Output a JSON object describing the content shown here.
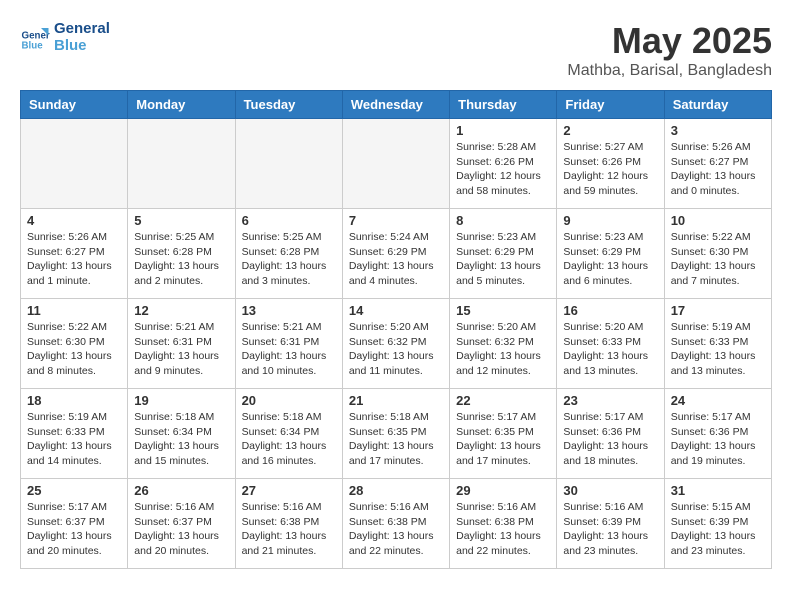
{
  "logo": {
    "line1": "General",
    "line2": "Blue"
  },
  "title": "May 2025",
  "location": "Mathba, Barisal, Bangladesh",
  "days_of_week": [
    "Sunday",
    "Monday",
    "Tuesday",
    "Wednesday",
    "Thursday",
    "Friday",
    "Saturday"
  ],
  "weeks": [
    [
      {
        "day": "",
        "info": ""
      },
      {
        "day": "",
        "info": ""
      },
      {
        "day": "",
        "info": ""
      },
      {
        "day": "",
        "info": ""
      },
      {
        "day": "1",
        "info": "Sunrise: 5:28 AM\nSunset: 6:26 PM\nDaylight: 12 hours and 58 minutes."
      },
      {
        "day": "2",
        "info": "Sunrise: 5:27 AM\nSunset: 6:26 PM\nDaylight: 12 hours and 59 minutes."
      },
      {
        "day": "3",
        "info": "Sunrise: 5:26 AM\nSunset: 6:27 PM\nDaylight: 13 hours and 0 minutes."
      }
    ],
    [
      {
        "day": "4",
        "info": "Sunrise: 5:26 AM\nSunset: 6:27 PM\nDaylight: 13 hours and 1 minute."
      },
      {
        "day": "5",
        "info": "Sunrise: 5:25 AM\nSunset: 6:28 PM\nDaylight: 13 hours and 2 minutes."
      },
      {
        "day": "6",
        "info": "Sunrise: 5:25 AM\nSunset: 6:28 PM\nDaylight: 13 hours and 3 minutes."
      },
      {
        "day": "7",
        "info": "Sunrise: 5:24 AM\nSunset: 6:29 PM\nDaylight: 13 hours and 4 minutes."
      },
      {
        "day": "8",
        "info": "Sunrise: 5:23 AM\nSunset: 6:29 PM\nDaylight: 13 hours and 5 minutes."
      },
      {
        "day": "9",
        "info": "Sunrise: 5:23 AM\nSunset: 6:29 PM\nDaylight: 13 hours and 6 minutes."
      },
      {
        "day": "10",
        "info": "Sunrise: 5:22 AM\nSunset: 6:30 PM\nDaylight: 13 hours and 7 minutes."
      }
    ],
    [
      {
        "day": "11",
        "info": "Sunrise: 5:22 AM\nSunset: 6:30 PM\nDaylight: 13 hours and 8 minutes."
      },
      {
        "day": "12",
        "info": "Sunrise: 5:21 AM\nSunset: 6:31 PM\nDaylight: 13 hours and 9 minutes."
      },
      {
        "day": "13",
        "info": "Sunrise: 5:21 AM\nSunset: 6:31 PM\nDaylight: 13 hours and 10 minutes."
      },
      {
        "day": "14",
        "info": "Sunrise: 5:20 AM\nSunset: 6:32 PM\nDaylight: 13 hours and 11 minutes."
      },
      {
        "day": "15",
        "info": "Sunrise: 5:20 AM\nSunset: 6:32 PM\nDaylight: 13 hours and 12 minutes."
      },
      {
        "day": "16",
        "info": "Sunrise: 5:20 AM\nSunset: 6:33 PM\nDaylight: 13 hours and 13 minutes."
      },
      {
        "day": "17",
        "info": "Sunrise: 5:19 AM\nSunset: 6:33 PM\nDaylight: 13 hours and 13 minutes."
      }
    ],
    [
      {
        "day": "18",
        "info": "Sunrise: 5:19 AM\nSunset: 6:33 PM\nDaylight: 13 hours and 14 minutes."
      },
      {
        "day": "19",
        "info": "Sunrise: 5:18 AM\nSunset: 6:34 PM\nDaylight: 13 hours and 15 minutes."
      },
      {
        "day": "20",
        "info": "Sunrise: 5:18 AM\nSunset: 6:34 PM\nDaylight: 13 hours and 16 minutes."
      },
      {
        "day": "21",
        "info": "Sunrise: 5:18 AM\nSunset: 6:35 PM\nDaylight: 13 hours and 17 minutes."
      },
      {
        "day": "22",
        "info": "Sunrise: 5:17 AM\nSunset: 6:35 PM\nDaylight: 13 hours and 17 minutes."
      },
      {
        "day": "23",
        "info": "Sunrise: 5:17 AM\nSunset: 6:36 PM\nDaylight: 13 hours and 18 minutes."
      },
      {
        "day": "24",
        "info": "Sunrise: 5:17 AM\nSunset: 6:36 PM\nDaylight: 13 hours and 19 minutes."
      }
    ],
    [
      {
        "day": "25",
        "info": "Sunrise: 5:17 AM\nSunset: 6:37 PM\nDaylight: 13 hours and 20 minutes."
      },
      {
        "day": "26",
        "info": "Sunrise: 5:16 AM\nSunset: 6:37 PM\nDaylight: 13 hours and 20 minutes."
      },
      {
        "day": "27",
        "info": "Sunrise: 5:16 AM\nSunset: 6:38 PM\nDaylight: 13 hours and 21 minutes."
      },
      {
        "day": "28",
        "info": "Sunrise: 5:16 AM\nSunset: 6:38 PM\nDaylight: 13 hours and 22 minutes."
      },
      {
        "day": "29",
        "info": "Sunrise: 5:16 AM\nSunset: 6:38 PM\nDaylight: 13 hours and 22 minutes."
      },
      {
        "day": "30",
        "info": "Sunrise: 5:16 AM\nSunset: 6:39 PM\nDaylight: 13 hours and 23 minutes."
      },
      {
        "day": "31",
        "info": "Sunrise: 5:15 AM\nSunset: 6:39 PM\nDaylight: 13 hours and 23 minutes."
      }
    ]
  ]
}
